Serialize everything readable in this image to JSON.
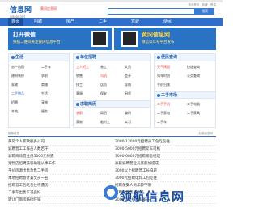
{
  "header": {
    "logo": "信息网",
    "domain": "gdaor.net",
    "city": "黄冈信息网",
    "links": "设为首页 · 收藏 · 登录",
    "search_btn": "搜索"
  },
  "nav": [
    "首页",
    "招聘",
    "房产",
    "二手",
    "驾驶",
    "便民"
  ],
  "banner1": {
    "title": "打开微信",
    "sub": "扫描二维码关注黄冈信息平台"
  },
  "banner2": {
    "title": "黄冈信息网",
    "sub": "微信公众号平台发布"
  },
  "panel1": {
    "title": "生活",
    "links": [
      "房产出租",
      "二手车",
      "建材装修",
      "求职",
      "家政",
      "商铺",
      "二手物品",
      "生活",
      "招聘",
      "宠物",
      "本地",
      "服务"
    ]
  },
  "panel2": {
    "title": "单位招聘",
    "sub": "求职简历",
    "links": [
      "工人招工",
      "普工",
      "文员",
      "销售",
      "司机",
      "会计",
      "技工",
      "店员",
      "导购",
      "客服",
      "保安",
      "厨师",
      "求职",
      "简历",
      "兼职",
      "家教",
      "临时工",
      "实习"
    ]
  },
  "panel3": {
    "title": "便民查询",
    "sub": "二手市场",
    "links": [
      "天气预报",
      "快递查询",
      "列车时刻",
      "公交查询",
      "手机归属",
      "二手手机",
      "二手电脑",
      "二手家电",
      "二手家具",
      "二手车"
    ]
  },
  "crumb": {
    "left": "推荐信息",
    "right": "分类信息网"
  },
  "list_left": [
    "黄冈个人家政服务公司",
    "诚聘普工工作员人数若干",
    "诚聘商场营业员5000元待遇",
    "宠物店招聘美容助理从事工作",
    "平价房源出售急售二手房",
    "本地招聘会计兼文员一名",
    "招聘普工包吃包住待遇优",
    "二手车出售车况良好",
    "转让门面房临街旺铺"
  ],
  "list_right": [
    "2000-12000元招聘员工包吃包住",
    "3000-5000元招聘叉车司机",
    "3000-6000元招聘销售经理",
    "高薪诚聘营业员底薪加提成",
    "3000以上招聘普工长白班",
    "3000元招聘电焊工包吃住",
    "招聘保安人员年龄不限",
    "诚聘厨师帮厨数名",
    "2000以上招聘服务员"
  ],
  "watermark": "领航信息网"
}
